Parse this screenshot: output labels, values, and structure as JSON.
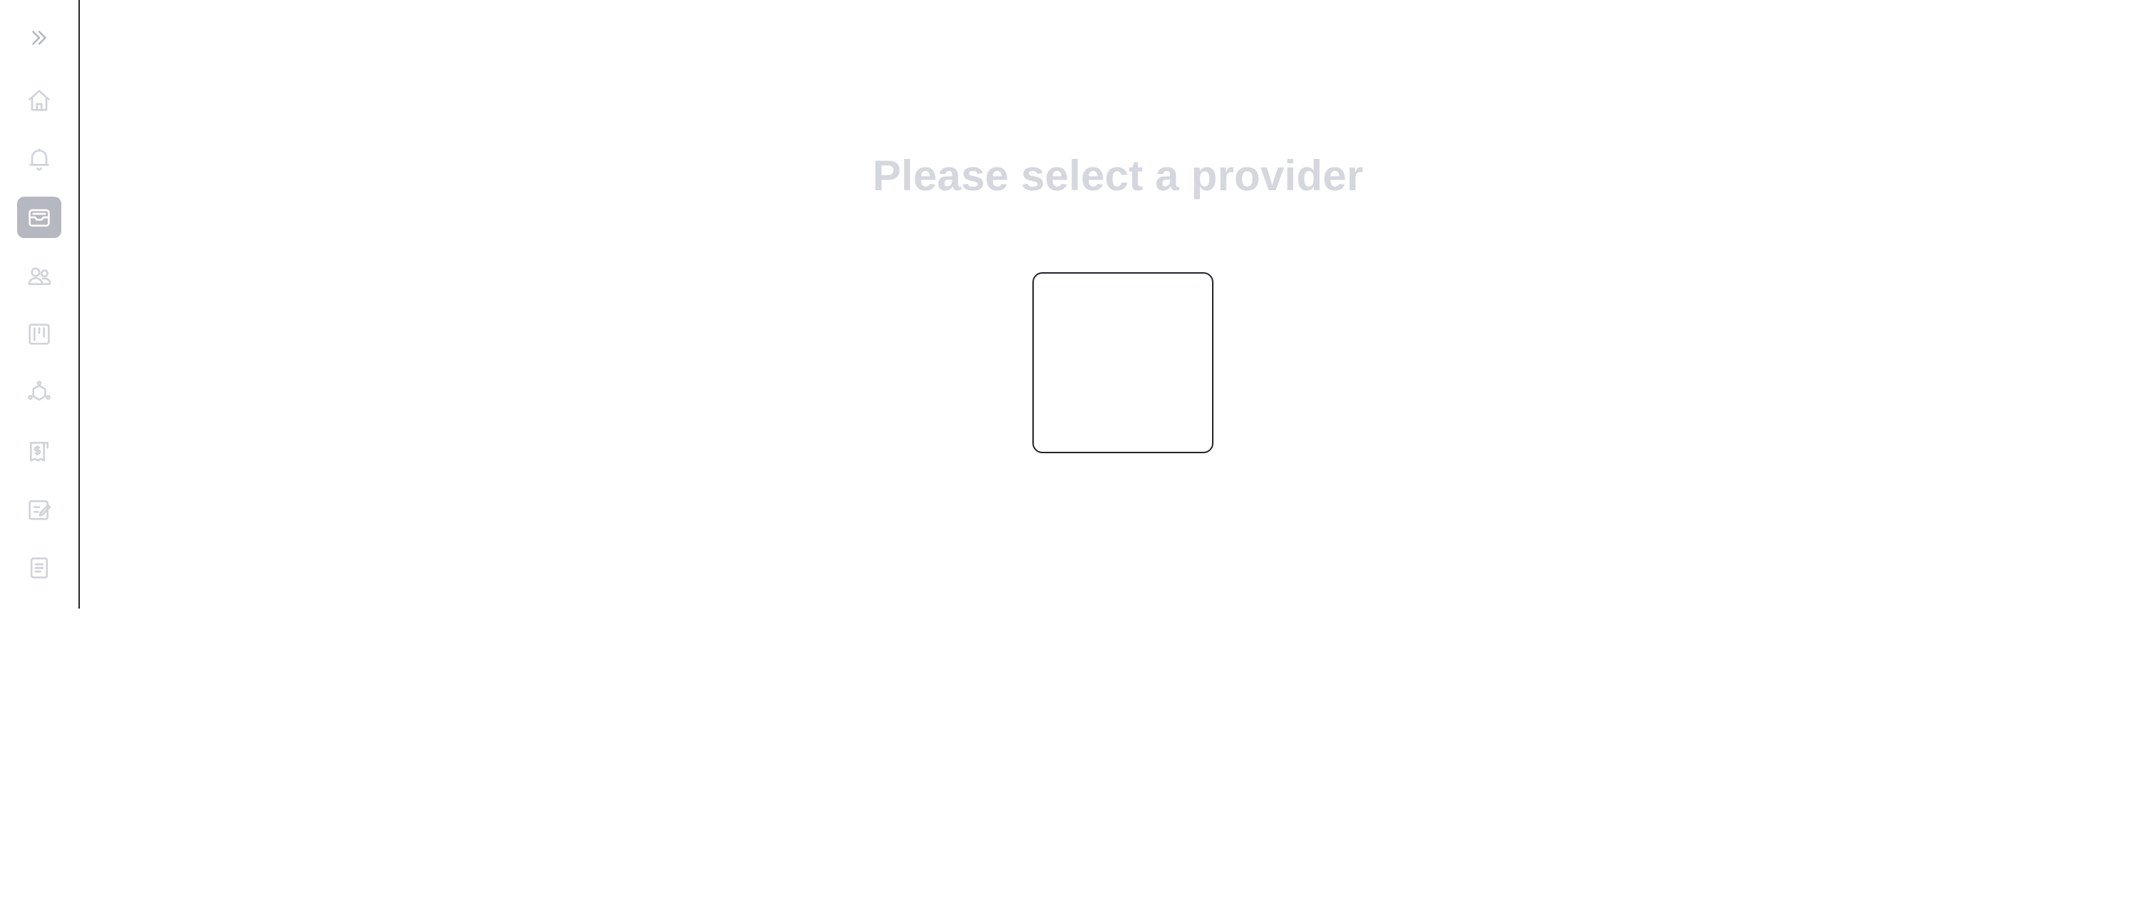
{
  "main": {
    "title": "Please select a provider"
  },
  "sidebar": {
    "toggle_icon": "chevrons-right-icon",
    "active_item": "inbox",
    "items": [
      {
        "id": "home",
        "icon": "home-icon"
      },
      {
        "id": "notifications",
        "icon": "bell-icon"
      },
      {
        "id": "inbox",
        "icon": "inbox-icon"
      },
      {
        "id": "contacts",
        "icon": "users-icon"
      },
      {
        "id": "board",
        "icon": "kanban-icon"
      },
      {
        "id": "integrations",
        "icon": "hexagon-nodes-icon"
      },
      {
        "id": "billing",
        "icon": "receipt-dollar-icon"
      },
      {
        "id": "notes",
        "icon": "edit-note-icon"
      },
      {
        "id": "documents",
        "icon": "document-icon"
      },
      {
        "id": "calendar",
        "icon": "calendar-icon"
      }
    ]
  },
  "colors": {
    "icon_muted": "#d0d3da",
    "active_bg": "#b5b8c1",
    "title_text": "#d5d7de",
    "border": "#23252b"
  }
}
